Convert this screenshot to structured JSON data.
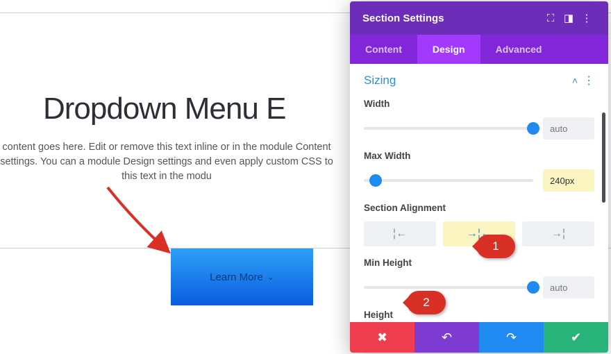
{
  "page": {
    "headline": "Dropdown Menu E",
    "sub": "content goes here. Edit or remove this text inline or in the module Content settings. You can a\nmodule Design settings and even apply custom CSS to this text in the modu",
    "learn_more": "Learn More"
  },
  "panel": {
    "title": "Section Settings",
    "tabs": {
      "content": "Content",
      "design": "Design",
      "advanced": "Advanced"
    },
    "group": "Sizing",
    "controls": {
      "width": {
        "label": "Width",
        "value": "auto",
        "knob_pct": 100
      },
      "max_width": {
        "label": "Max Width",
        "value": "240px",
        "knob_pct": 7
      },
      "alignment": {
        "label": "Section Alignment"
      },
      "min_height": {
        "label": "Min Height",
        "value": "auto",
        "knob_pct": 100
      },
      "height": {
        "label": "Height"
      }
    }
  },
  "callouts": {
    "one": "1",
    "two": "2"
  }
}
